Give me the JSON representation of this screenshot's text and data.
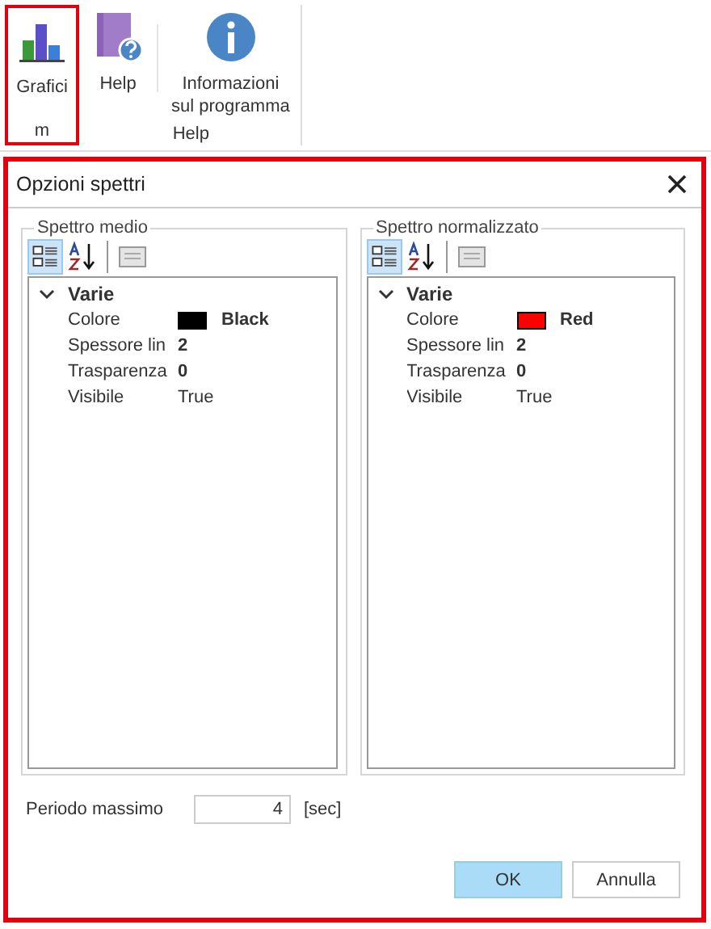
{
  "ribbon": {
    "groups": [
      {
        "label": "m",
        "highlighted": true,
        "buttons": [
          {
            "label": "Grafici",
            "kind": "chart"
          }
        ]
      },
      {
        "label": "Help",
        "highlighted": false,
        "buttons": [
          {
            "label": "Help",
            "kind": "book"
          },
          {
            "label": "Informazioni\nsul programma",
            "kind": "info"
          }
        ]
      }
    ]
  },
  "dialog": {
    "title": "Opzioni spettri",
    "highlighted": true,
    "panels": [
      {
        "title": "Spettro medio",
        "categorized": true,
        "category": {
          "name": "Varie",
          "expanded": true,
          "properties": [
            {
              "name": "Colore",
              "value": "Black",
              "kind": "color",
              "color": "#000000",
              "modified": true
            },
            {
              "name": "Spessore lin",
              "value": "2",
              "kind": "text",
              "modified": true
            },
            {
              "name": "Trasparenza",
              "value": "0",
              "kind": "text",
              "modified": true
            },
            {
              "name": "Visibile",
              "value": "True",
              "kind": "text",
              "modified": false
            }
          ]
        }
      },
      {
        "title": "Spettro normalizzato",
        "categorized": true,
        "category": {
          "name": "Varie",
          "expanded": true,
          "properties": [
            {
              "name": "Colore",
              "value": "Red",
              "kind": "color",
              "color": "#ff0000",
              "modified": true
            },
            {
              "name": "Spessore lin",
              "value": "2",
              "kind": "text",
              "modified": true
            },
            {
              "name": "Trasparenza",
              "value": "0",
              "kind": "text",
              "modified": true
            },
            {
              "name": "Visibile",
              "value": "True",
              "kind": "text",
              "modified": false
            }
          ]
        }
      }
    ],
    "period": {
      "label": "Periodo massimo",
      "value": "4",
      "unit": "[sec]"
    },
    "buttons": [
      {
        "label": "OK",
        "default": true
      },
      {
        "label": "Annulla",
        "default": false
      }
    ]
  }
}
